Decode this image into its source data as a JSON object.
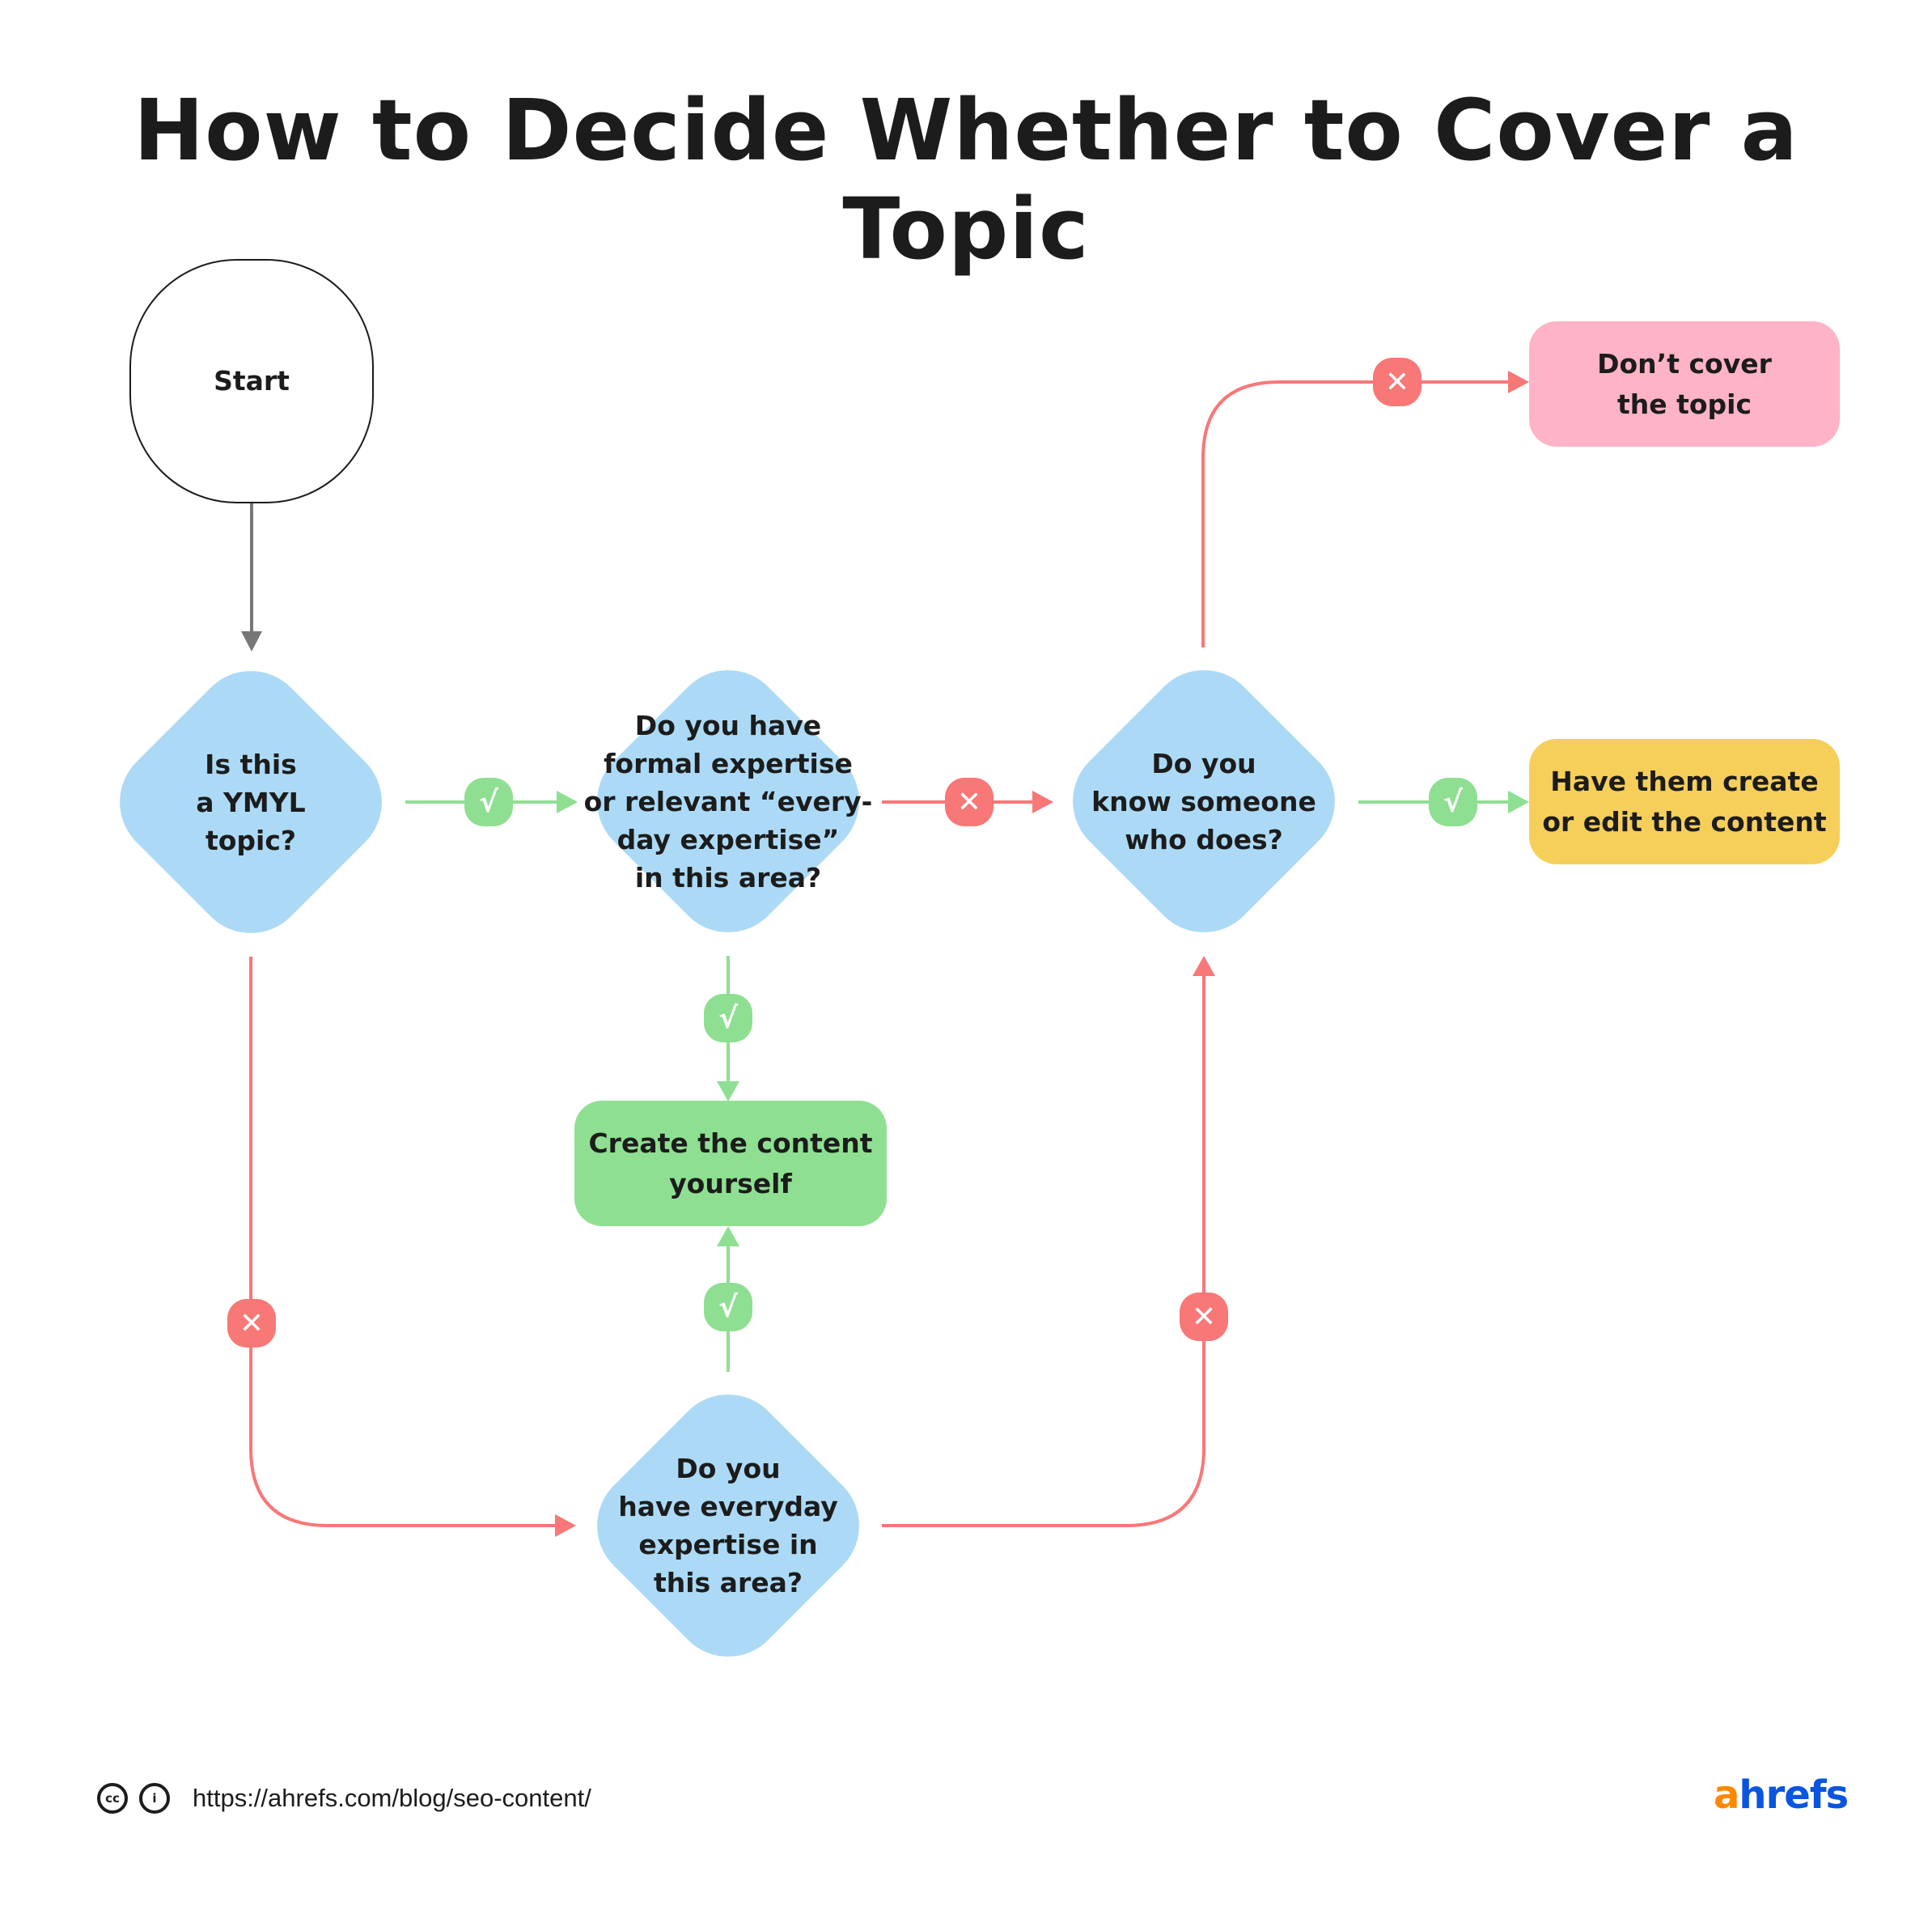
{
  "title": "How to Decide Whether to Cover a Topic",
  "colors": {
    "decision": "#acdaf6",
    "yes": "#8fdf92",
    "no": "#f87777",
    "start_arrow": "#777777",
    "dont_cover": "#ffb3c6",
    "have_them": "#f6cf5a",
    "create_yourself": "#8fdf92",
    "logo_a": "#ff8800",
    "logo_rest": "#0a55e0"
  },
  "nodes": {
    "start": "Start",
    "ymyl": "Is this\na YMYL\ntopic?",
    "formal_expertise": "Do you have\nformal expertise\nor relevant “every-\nday expertise”\nin this area?",
    "know_someone": "Do you\nknow someone\nwho does?",
    "everyday_expertise": "Do you\nhave everyday\nexpertise in\nthis area?",
    "dont_cover": "Don’t cover\nthe topic",
    "have_them": "Have them create\nor edit the content",
    "create_yourself": "Create the content\nyourself"
  },
  "badges": {
    "yes_symbol": "√",
    "no_symbol": "✕"
  },
  "footer": {
    "cc_icon": "cc",
    "by_icon": "i",
    "url": "https://ahrefs.com/blog/seo-content/"
  },
  "logo": {
    "first": "a",
    "rest": "hrefs"
  }
}
